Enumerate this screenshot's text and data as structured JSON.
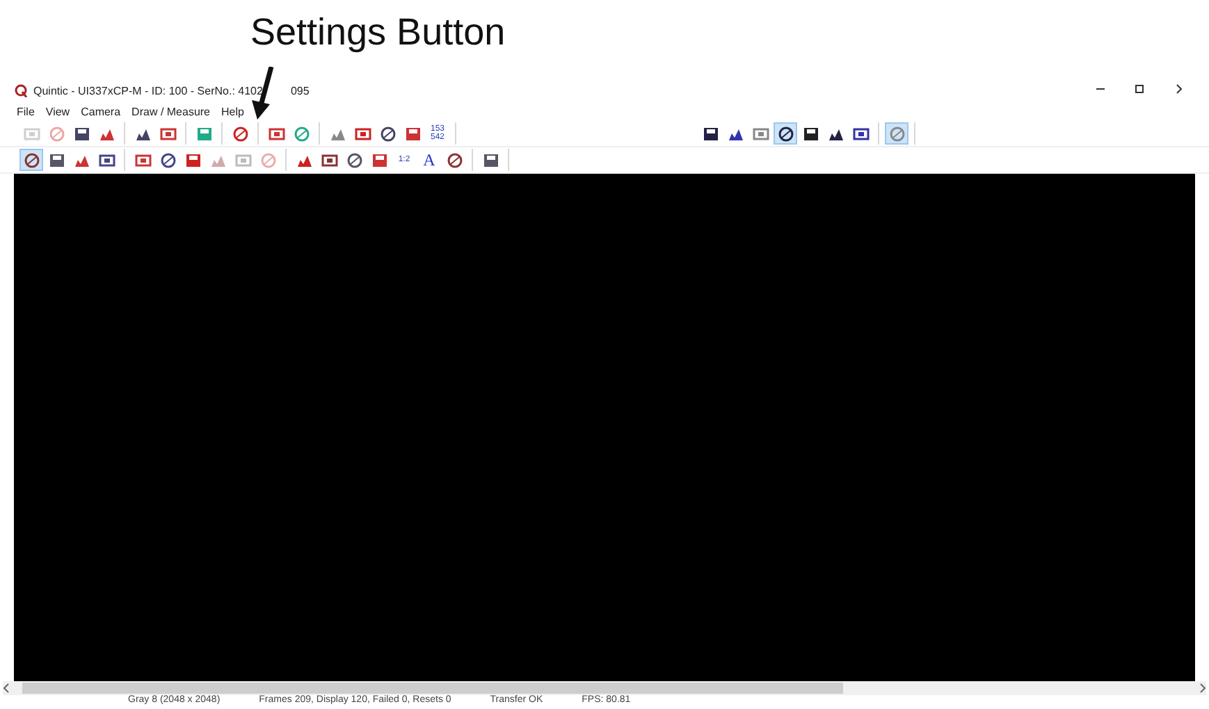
{
  "annotation": {
    "label": "Settings Button"
  },
  "window": {
    "title": "Quintic - UI337xCP-M - ID: 100 - SerNo.: 4102",
    "title_tail": "095"
  },
  "menu": [
    {
      "label": "File"
    },
    {
      "label": "View"
    },
    {
      "label": "Camera"
    },
    {
      "label": "Draw / Measure"
    },
    {
      "label": "Help"
    }
  ],
  "toolbars": [
    {
      "groups": [
        [
          {
            "selected": false,
            "disabled": true
          },
          {
            "selected": false,
            "disabled": true
          },
          {
            "selected": false,
            "disabled": false
          },
          {
            "selected": false,
            "disabled": false
          }
        ],
        [
          {
            "selected": false,
            "disabled": false
          },
          {
            "selected": false,
            "disabled": false
          }
        ],
        [
          {
            "selected": false,
            "disabled": false
          }
        ],
        [
          {
            "selected": false,
            "disabled": false
          }
        ],
        [
          {
            "selected": false,
            "disabled": false
          },
          {
            "selected": false,
            "disabled": false
          }
        ],
        [
          {
            "selected": false,
            "disabled": false
          },
          {
            "selected": false,
            "disabled": false
          },
          {
            "selected": false,
            "disabled": false
          },
          {
            "selected": false,
            "disabled": false
          },
          {
            "selected": false,
            "disabled": false,
            "label": "153\n542"
          }
        ]
      ],
      "right_groups": [
        [
          {
            "selected": false,
            "disabled": false
          },
          {
            "selected": false,
            "disabled": false
          },
          {
            "selected": false,
            "disabled": false
          },
          {
            "selected": true,
            "disabled": false
          },
          {
            "selected": false,
            "disabled": false
          },
          {
            "selected": false,
            "disabled": false
          },
          {
            "selected": false,
            "disabled": false
          }
        ],
        [
          {
            "selected": true,
            "disabled": false
          }
        ]
      ]
    },
    {
      "groups": [
        [
          {
            "selected": true,
            "disabled": false
          },
          {
            "selected": false,
            "disabled": false
          },
          {
            "selected": false,
            "disabled": false
          },
          {
            "selected": false,
            "disabled": false
          }
        ],
        [
          {
            "selected": false,
            "disabled": false
          },
          {
            "selected": false,
            "disabled": false
          },
          {
            "selected": false,
            "disabled": false
          },
          {
            "selected": false,
            "disabled": true
          },
          {
            "selected": false,
            "disabled": true
          },
          {
            "selected": false,
            "disabled": true
          }
        ],
        [
          {
            "selected": false,
            "disabled": false
          },
          {
            "selected": false,
            "disabled": false
          },
          {
            "selected": false,
            "disabled": false
          },
          {
            "selected": false,
            "disabled": false
          },
          {
            "selected": false,
            "disabled": false,
            "label": "1:2"
          },
          {
            "selected": false,
            "disabled": false,
            "label": "A"
          },
          {
            "selected": false,
            "disabled": false
          }
        ],
        [
          {
            "selected": false,
            "disabled": false
          }
        ]
      ]
    }
  ],
  "status_bar": [
    "Gray 8 (2048 x 2048)",
    "Frames 209, Display 120, Failed 0, Resets 0",
    "Transfer OK",
    "FPS: 80.81"
  ]
}
